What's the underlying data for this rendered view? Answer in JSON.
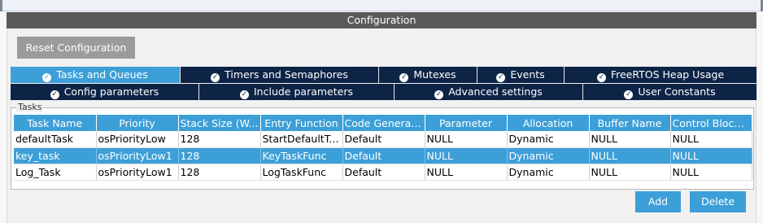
{
  "header": {
    "title": "Configuration"
  },
  "toolbar": {
    "reset_label": "Reset Configuration"
  },
  "tabs_row1": [
    {
      "label": "Tasks and Queues",
      "active": true,
      "icon": "check-circle-icon"
    },
    {
      "label": "Timers and Semaphores",
      "active": false,
      "icon": "check-circle-icon"
    },
    {
      "label": "Mutexes",
      "active": false,
      "icon": "check-circle-icon"
    },
    {
      "label": "Events",
      "active": false,
      "icon": "check-circle-icon"
    },
    {
      "label": "FreeRTOS Heap Usage",
      "active": false,
      "icon": "check-circle-icon"
    }
  ],
  "tabs_row2": [
    {
      "label": "Config parameters",
      "icon": "check-circle-icon"
    },
    {
      "label": "Include parameters",
      "icon": "check-circle-icon"
    },
    {
      "label": "Advanced settings",
      "icon": "check-circle-icon"
    },
    {
      "label": "User Constants",
      "icon": "check-circle-icon"
    }
  ],
  "tasks": {
    "legend": "Tasks",
    "columns": [
      "Task Name",
      "Priority",
      "Stack Size (W...",
      "Entry Function",
      "Code Generati...",
      "Parameter",
      "Allocation",
      "Buffer Name",
      "Control Block ..."
    ],
    "rows": [
      [
        "defaultTask",
        "osPriorityLow",
        "128",
        "StartDefaultTask",
        "Default",
        "NULL",
        "Dynamic",
        "NULL",
        "NULL"
      ],
      [
        "key_task",
        "osPriorityLow1",
        "128",
        "KeyTaskFunc",
        "Default",
        "NULL",
        "Dynamic",
        "NULL",
        "NULL"
      ],
      [
        "Log_Task",
        "osPriorityLow1",
        "128",
        "LogTaskFunc",
        "Default",
        "NULL",
        "Dynamic",
        "NULL",
        "NULL"
      ]
    ],
    "selected_row": 1
  },
  "actions": {
    "add_label": "Add",
    "delete_label": "Delete"
  },
  "colors": {
    "accent": "#3d9fd7",
    "tab_dark": "#0d2446",
    "header": "#5a5a5a"
  }
}
